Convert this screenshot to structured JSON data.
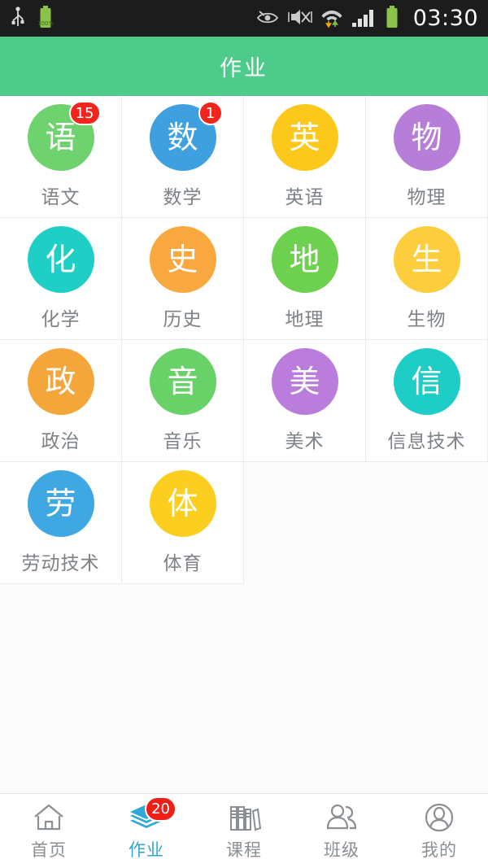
{
  "statusbar": {
    "time": "03:30",
    "battery_percent": "100%",
    "icons": [
      "usb-icon",
      "battery-charging-icon",
      "eye-care-icon",
      "vibrate-mute-icon",
      "wifi-data-icon",
      "signal-bars-icon",
      "battery-icon"
    ]
  },
  "header": {
    "title": "作业"
  },
  "subjects": [
    {
      "char": "语",
      "label": "语文",
      "color": "#6ed36e",
      "badge": "15"
    },
    {
      "char": "数",
      "label": "数学",
      "color": "#3fa0e0",
      "badge": "1"
    },
    {
      "char": "英",
      "label": "英语",
      "color": "#fcc81c",
      "badge": ""
    },
    {
      "char": "物",
      "label": "物理",
      "color": "#b77ed9",
      "badge": ""
    },
    {
      "char": "化",
      "label": "化学",
      "color": "#1fcfc6",
      "badge": ""
    },
    {
      "char": "史",
      "label": "历史",
      "color": "#f9a83f",
      "badge": ""
    },
    {
      "char": "地",
      "label": "地理",
      "color": "#6ed04f",
      "badge": ""
    },
    {
      "char": "生",
      "label": "生物",
      "color": "#fcce3e",
      "badge": ""
    },
    {
      "char": "政",
      "label": "政治",
      "color": "#f5a63a",
      "badge": ""
    },
    {
      "char": "音",
      "label": "音乐",
      "color": "#68d168",
      "badge": ""
    },
    {
      "char": "美",
      "label": "美术",
      "color": "#bb7ddc",
      "badge": ""
    },
    {
      "char": "信",
      "label": "信息技术",
      "color": "#1ecdc6",
      "badge": ""
    },
    {
      "char": "劳",
      "label": "劳动技术",
      "color": "#3fa8e3",
      "badge": ""
    },
    {
      "char": "体",
      "label": "体育",
      "color": "#fcce20",
      "badge": ""
    }
  ],
  "bottomnav": {
    "items": [
      {
        "label": "首页",
        "icon": "home-icon",
        "badge": "",
        "active": false
      },
      {
        "label": "作业",
        "icon": "layers-icon",
        "badge": "20",
        "active": true
      },
      {
        "label": "课程",
        "icon": "books-icon",
        "badge": "",
        "active": false
      },
      {
        "label": "班级",
        "icon": "group-icon",
        "badge": "",
        "active": false
      },
      {
        "label": "我的",
        "icon": "profile-icon",
        "badge": "",
        "active": false
      }
    ],
    "active_color": "#2fa8d8",
    "inactive_color": "#8a8f94"
  }
}
